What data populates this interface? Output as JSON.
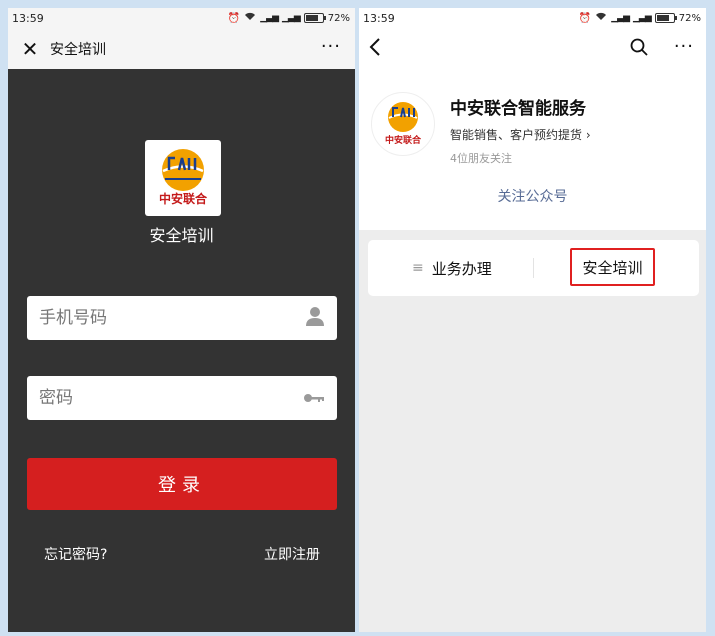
{
  "left": {
    "status": {
      "time": "13:59",
      "battery": "72%"
    },
    "nav": {
      "close": "✕",
      "title": "安全培训",
      "more": "···"
    },
    "app_name": "安全培训",
    "logo_text": "中安联合",
    "phone_placeholder": "手机号码",
    "password_placeholder": "密码",
    "login_label": "登录",
    "forgot_label": "忘记密码?",
    "register_label": "立即注册"
  },
  "right": {
    "status": {
      "time": "13:59",
      "battery": "72%"
    },
    "nav": {
      "back": "‹",
      "more": "···"
    },
    "account_name": "中安联合智能服务",
    "account_desc": "智能销售、客户预约提货 ›",
    "followers": "4位朋友关注",
    "follow_label": "关注公众号",
    "logo_text": "中安联合",
    "menu": [
      {
        "icon": "≡",
        "label": "业务办理"
      },
      {
        "label": "安全培训"
      }
    ]
  },
  "colors": {
    "accent_red": "#d51f1f",
    "link_blue": "#576b95",
    "highlight": "#e02020"
  }
}
